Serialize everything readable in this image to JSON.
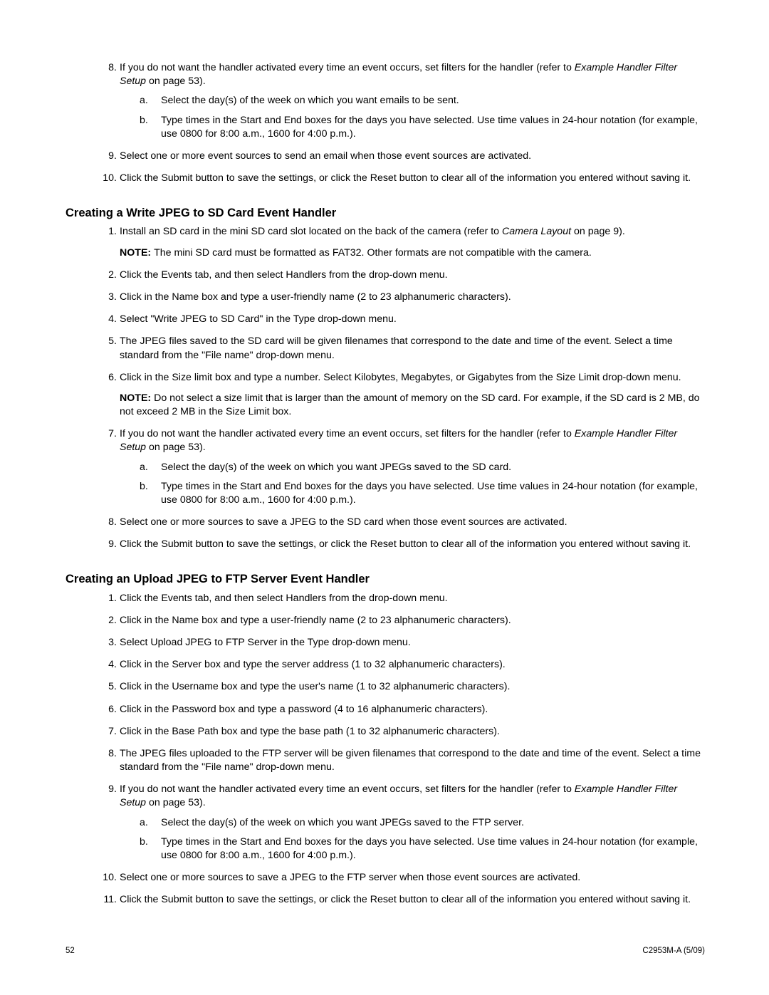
{
  "section1": {
    "start": 7,
    "items": [
      {
        "text_pre": "If you do not want the handler activated every time an event occurs, set filters for the handler (refer to ",
        "ref": "Example Handler Filter Setup",
        "text_post": " on page 53).",
        "sub": [
          "Select the day(s) of the week on which you want emails to be sent.",
          "Type times in the Start and End boxes for the days you have selected. Use time values in 24-hour notation (for example, use 0800 for 8:00 a.m., 1600 for 4:00 p.m.)."
        ]
      },
      {
        "text": "Select one or more event sources to send an email when those event sources are activated."
      },
      {
        "text": "Click the Submit button to save the settings, or click the Reset button to clear all of the information you entered without saving it."
      }
    ]
  },
  "section2": {
    "heading": "Creating a Write JPEG to SD Card Event Handler",
    "start": 0,
    "items": [
      {
        "text_pre": "Install an SD card in the mini SD card slot located on the back of the camera (refer to ",
        "ref": "Camera Layout",
        "text_post": " on page 9).",
        "note": "The mini SD card must be formatted as FAT32. Other formats are not compatible with the camera."
      },
      {
        "text": "Click the Events tab, and then select Handlers from the drop-down menu."
      },
      {
        "text": "Click in the Name box and type a user-friendly name (2 to 23 alphanumeric characters)."
      },
      {
        "text": "Select \"Write JPEG to SD Card\" in the Type drop-down menu."
      },
      {
        "text": "The JPEG files saved to the SD card will be given filenames that correspond to the date and time of the event. Select a time standard from the \"File name\" drop-down menu."
      },
      {
        "text": "Click in the Size limit box and type a number. Select Kilobytes, Megabytes, or Gigabytes from the Size Limit drop-down menu.",
        "note": "Do not select a size limit that is larger than the amount of memory on the SD card. For example, if the SD card is 2 MB, do not exceed 2 MB in the Size Limit box."
      },
      {
        "text_pre": "If you do not want the handler activated every time an event occurs, set filters for the handler (refer to ",
        "ref": "Example Handler Filter Setup",
        "text_post": " on page 53).",
        "sub": [
          "Select the day(s) of the week on which you want JPEGs saved to the SD card.",
          "Type times in the Start and End boxes for the days you have selected. Use time values in 24-hour notation (for example, use 0800 for 8:00 a.m., 1600 for 4:00 p.m.)."
        ]
      },
      {
        "text": "Select one or more sources to save a JPEG to the SD card when those event sources are activated."
      },
      {
        "text": "Click the Submit button to save the settings, or click the Reset button to clear all of the information you entered without saving it."
      }
    ]
  },
  "section3": {
    "heading": "Creating an Upload JPEG to FTP Server Event Handler",
    "start": 0,
    "items": [
      {
        "text": "Click the Events tab, and then select Handlers from the drop-down menu."
      },
      {
        "text": "Click in the Name box and type a user-friendly name (2 to 23 alphanumeric characters)."
      },
      {
        "text": "Select Upload JPEG to FTP Server in the Type drop-down menu."
      },
      {
        "text": "Click in the Server box and type the server address (1 to 32 alphanumeric characters)."
      },
      {
        "text": "Click in the Username box and type the user's name (1 to 32 alphanumeric characters)."
      },
      {
        "text": "Click in the Password box and type a password (4 to 16 alphanumeric characters)."
      },
      {
        "text": "Click in the Base Path box and type the base path (1 to 32 alphanumeric characters)."
      },
      {
        "text": "The JPEG files uploaded to the FTP server will be given filenames that correspond to the date and time of the event. Select a time standard from the \"File name\" drop-down menu."
      },
      {
        "text_pre": "If you do not want the handler activated every time an event occurs, set filters for the handler (refer to ",
        "ref": "Example Handler Filter Setup",
        "text_post": " on page 53).",
        "sub": [
          "Select the day(s) of the week on which you want JPEGs saved to the FTP server.",
          "Type times in the Start and End boxes for the days you have selected. Use time values in 24-hour notation (for example, use 0800 for 8:00 a.m., 1600 for 4:00 p.m.)."
        ]
      },
      {
        "text": "Select one or more sources to save a JPEG to the FTP server when those event sources are activated."
      },
      {
        "text": "Click the Submit button to save the settings, or click the Reset button to clear all of the information you entered without saving it."
      }
    ]
  },
  "labels": {
    "note": "NOTE:"
  },
  "footer": {
    "page": "52",
    "doc": "C2953M-A (5/09)"
  }
}
